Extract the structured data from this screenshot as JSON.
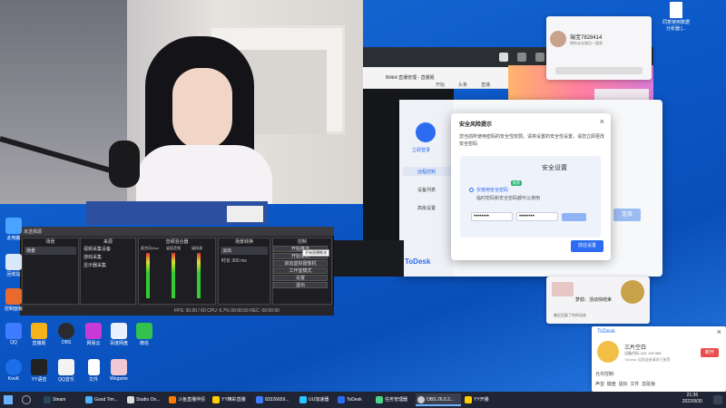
{
  "colors": {
    "accent": "#2d6cf0",
    "taskbar": "#1f2535",
    "obs_bg": "#2b2b2f",
    "desktop": "#0b57c8"
  },
  "security_dialog": {
    "title": "安全风险提示",
    "message": "您当前所使用密码的安全性较弱，请将设置的安全性设置，请您立即更改安全密码",
    "inner_title": "安全设置",
    "option_label": "仅使用安全密码",
    "option_badge": "推荐",
    "option_desc": "临时密码和安全密码都可以使用",
    "password_1": "••••••••",
    "password_2": "••••••••",
    "confirm_button": "前往设置",
    "back_window_version": "v4.3.1",
    "back_window_link": "立即登录",
    "back_window_btn": "连接"
  },
  "todesk_side": {
    "items": [
      "远程控制",
      "设备列表",
      "高级设置"
    ],
    "brand": "ToDesk"
  },
  "obs": {
    "title": "未选择源",
    "panels": [
      "场景",
      "来源",
      "音频混合器",
      "场景转换",
      "控制"
    ],
    "scene_item": "场景",
    "sources": [
      "视频采集设备",
      "游戏采集",
      "显示器采集"
    ],
    "mixer_channels": [
      "麦克风/Aux",
      "桌面音频",
      "媒体源"
    ],
    "transition_value": "淡出",
    "duration_label": "时长",
    "duration_value": "300 ms",
    "controls": [
      "开始推流",
      "开始录制",
      "启动虚拟摄像机",
      "工作室模式",
      "设置",
      "退出"
    ],
    "tooltip": "开始直播推流",
    "status": "FPS: 30.00 / 60  CPU: 6.7%  00:00:00  REC: 00:00:00"
  },
  "chat_top": {
    "name": "瑞宝7828414",
    "subtitle": "带你去长城见一面吧"
  },
  "chat_small": {
    "text": "梦鸽：活动快结束",
    "sub": "最近回复了你的动态"
  },
  "todesk_pop": {
    "brand": "ToDesk",
    "name": "三片空白",
    "device": "设备代码: 621 139 986",
    "desc": "ToDesk 远程连接请求已接受",
    "button": "断开",
    "hint": "允许控制:",
    "perms": [
      "声音",
      "键盘",
      "鼠标",
      "文件",
      "剪贴板"
    ]
  },
  "browser_bar": {
    "tab": "Bilibili 直播管理 - 直播姬",
    "tabs": [
      "开始",
      "头条",
      "直播"
    ]
  },
  "desktop_file": {
    "label": "同意使用数据分析器 [..."
  },
  "left_icons": [
    "此电脑",
    "回收站",
    "控制面板"
  ],
  "desktop_icons_row1": [
    "QQ",
    "直播姬",
    "OBS",
    "网易云",
    "百度网盘",
    "微信"
  ],
  "desktop_icons_row2": [
    "KooK",
    "YY语音",
    "QQ音乐",
    "文件",
    "Wegame"
  ],
  "taskbar": {
    "items": [
      "Steam",
      "Good Tim...",
      "Studio On...",
      "斗鱼直播伴侣",
      "YY精彩直播",
      "83326659...",
      "UU加速器",
      "ToDesk",
      "任务管理器",
      "OBS 26.0.2...",
      "YY开播"
    ],
    "time": "21:36",
    "date": "2022/9/30"
  }
}
